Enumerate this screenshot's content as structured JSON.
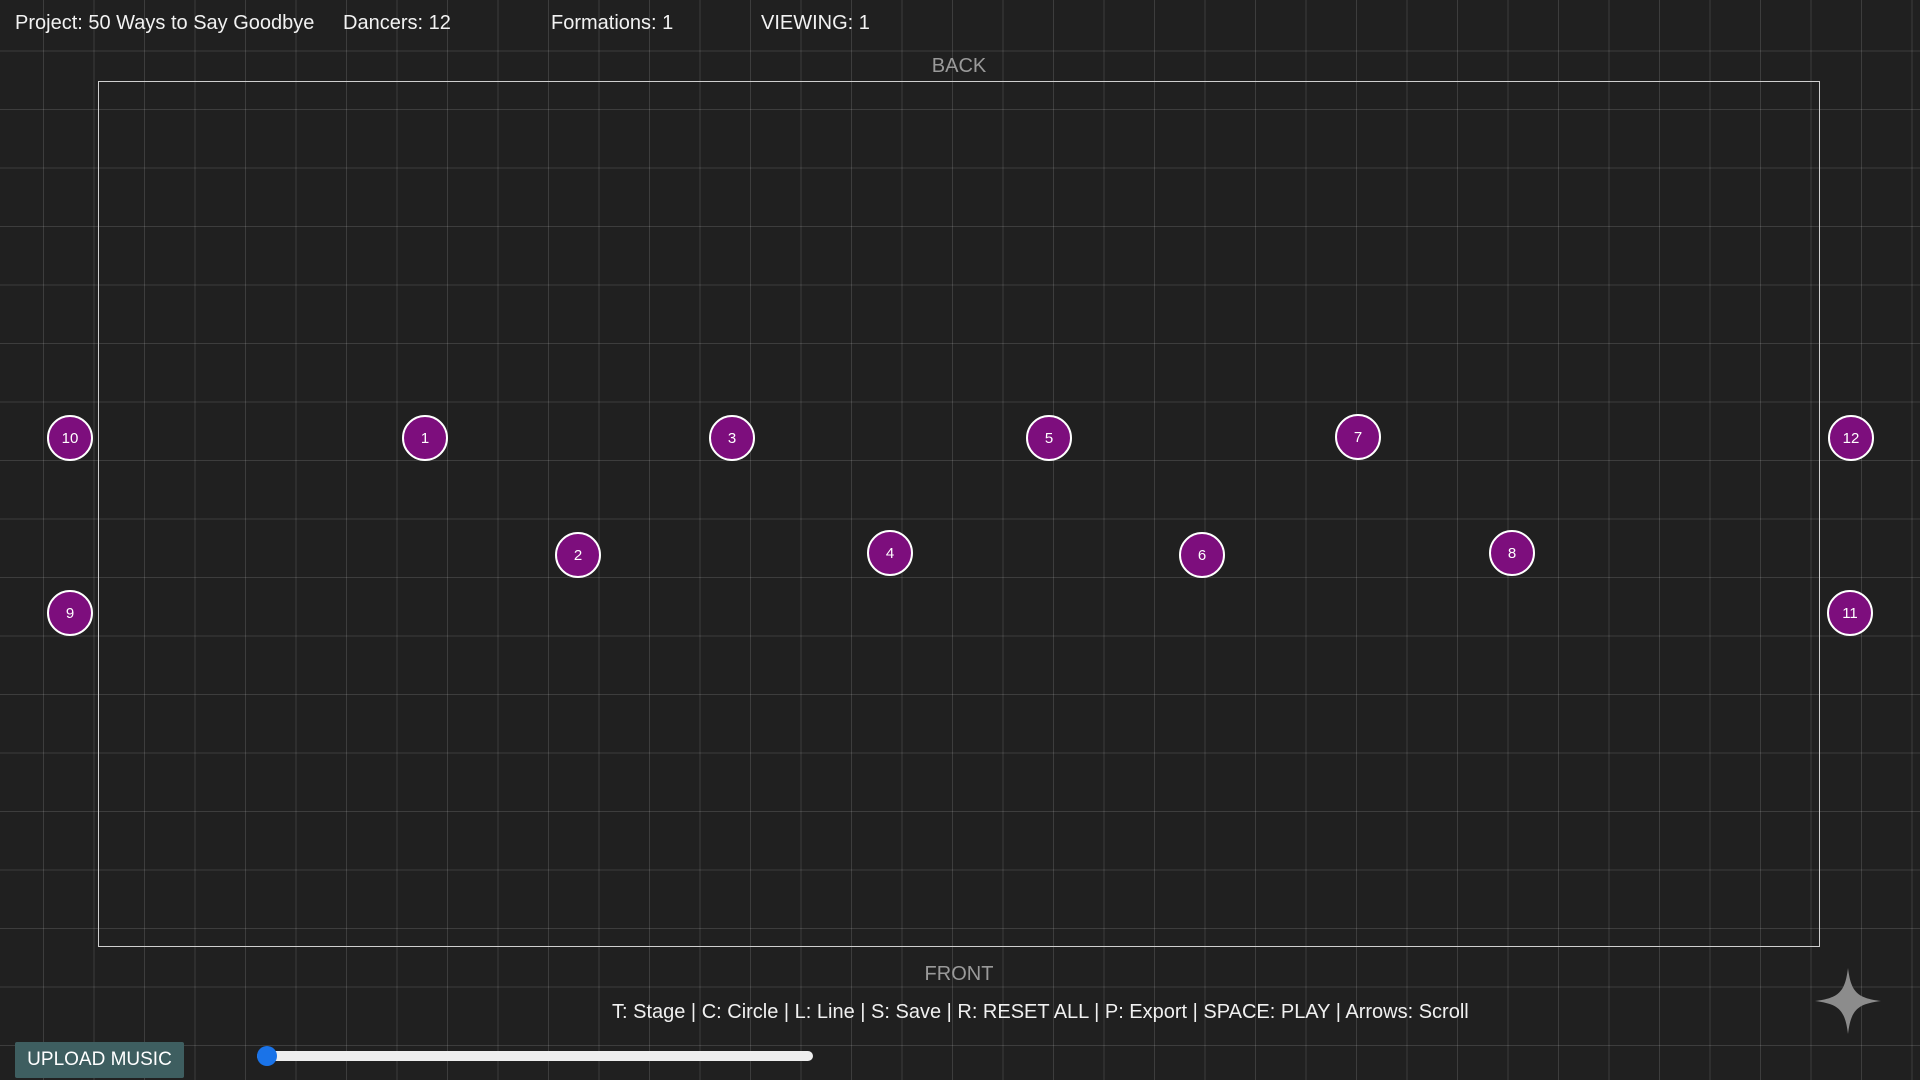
{
  "header": {
    "project": "Project: 50 Ways to Say Goodbye",
    "dancers": "Dancers: 12",
    "formations": "Formations: 1",
    "viewing": "VIEWING: 1"
  },
  "stage": {
    "back_label": "BACK",
    "front_label": "FRONT"
  },
  "dancers": [
    {
      "label": "10"
    },
    {
      "label": "1"
    },
    {
      "label": "3"
    },
    {
      "label": "5"
    },
    {
      "label": "7"
    },
    {
      "label": "12"
    },
    {
      "label": "2"
    },
    {
      "label": "4"
    },
    {
      "label": "6"
    },
    {
      "label": "8"
    },
    {
      "label": "9"
    },
    {
      "label": "11"
    }
  ],
  "footer": {
    "shortcuts": "T: Stage | C: Circle | L: Line | S: Save | R: RESET ALL | P: Export | SPACE: PLAY | Arrows: Scroll",
    "upload_label": "UPLOAD MUSIC",
    "timeline_progress": 0
  },
  "icons": {
    "corner": "sparkle-icon"
  },
  "colors": {
    "background": "#202020",
    "dancer_fill": "#7d0e7d",
    "dancer_border": "#ffffff",
    "upload_button": "#3e5e60",
    "timeline_thumb": "#1a73e8"
  }
}
